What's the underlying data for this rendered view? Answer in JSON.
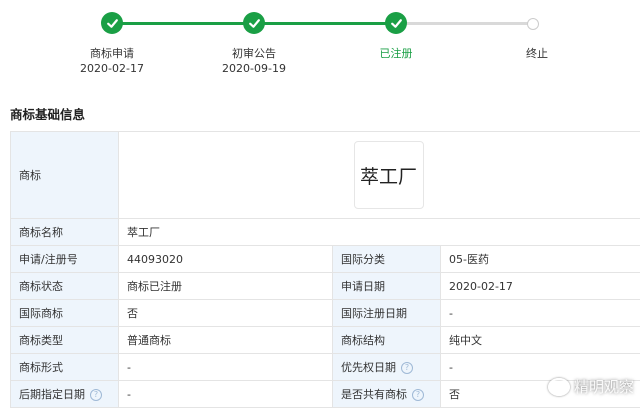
{
  "progress": {
    "steps": [
      {
        "label": "商标申请",
        "date": "2020-02-17",
        "status": "done"
      },
      {
        "label": "初审公告",
        "date": "2020-09-19",
        "status": "done"
      },
      {
        "label": "已注册",
        "date": "",
        "status": "current"
      },
      {
        "label": "终止",
        "date": "",
        "status": "pending"
      }
    ],
    "colors": {
      "done": "#1a9f45",
      "pending": "#d9d9d9"
    }
  },
  "section": {
    "title": "商标基础信息"
  },
  "table": {
    "logo_label": "商标",
    "logo_text": "萃工厂",
    "name_label": "商标名称",
    "name_value": "萃工厂",
    "rows": [
      {
        "l1": "申请/注册号",
        "v1": "44093020",
        "l2": "国际分类",
        "v2": "05-医药"
      },
      {
        "l1": "商标状态",
        "v1": "商标已注册",
        "l2": "申请日期",
        "v2": "2020-02-17"
      },
      {
        "l1": "国际商标",
        "v1": "否",
        "l2": "国际注册日期",
        "v2": "-"
      },
      {
        "l1": "商标类型",
        "v1": "普通商标",
        "l2": "商标结构",
        "v2": "纯中文"
      },
      {
        "l1": "商标形式",
        "v1": "-",
        "l2": "优先权日期",
        "v2": "-"
      },
      {
        "l1": "后期指定日期",
        "v1": "-",
        "l2": "是否共有商标",
        "v2": "否"
      }
    ],
    "help_icon": "?"
  },
  "watermark": {
    "text": "精明观察"
  }
}
